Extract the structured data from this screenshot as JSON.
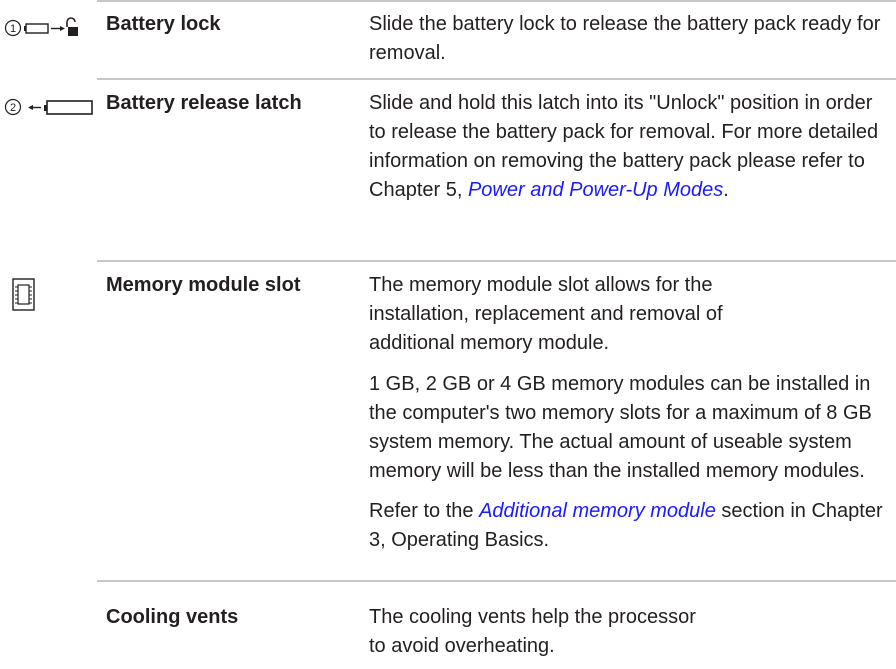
{
  "rows": {
    "battery_lock": {
      "icon": "battery-lock-icon",
      "term": "Battery lock",
      "desc": "Slide the battery lock to release the battery pack ready for removal."
    },
    "battery_release": {
      "icon": "battery-release-latch-icon",
      "term": "Battery release latch",
      "desc_pre": "Slide and hold this latch into its \"Unlock\" position in order to release the battery pack for removal. For more detailed information on removing the battery pack please refer to Chapter 5, ",
      "link": "Power and Power-Up Modes",
      "desc_post": "."
    },
    "memory_slot": {
      "icon": "memory-module-icon",
      "term": "Memory module slot",
      "desc1": "The memory module slot allows for the installation, replacement and removal of additional memory module.",
      "desc2": "1 GB, 2 GB or 4 GB memory modules can be installed in the computer's two memory slots for a maximum of 8 GB system memory. The actual amount of useable system memory will be less than the installed memory modules.",
      "desc3_pre": "Refer to the ",
      "link": "Additional memory module",
      "desc3_post": " section in Chapter 3, Operating Basics."
    },
    "cooling_vents": {
      "term": "Cooling vents",
      "desc": "The cooling vents help the processor to avoid overheating."
    }
  },
  "colors": {
    "text": "#231f20",
    "link": "#1a1aff",
    "rule": "#c8c8c8"
  }
}
